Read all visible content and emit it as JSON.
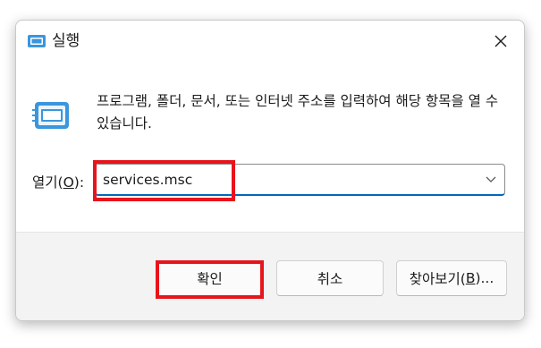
{
  "window": {
    "title": "실행",
    "title_icon": "run-icon",
    "close_icon": "close-icon"
  },
  "content": {
    "description": "프로그램, 폴더, 문서, 또는 인터넷 주소를 입력하여 해당 항목을 열 수 있습니다.",
    "open_label_prefix": "열기(",
    "open_label_mnemonic": "O",
    "open_label_suffix": "):",
    "open_value": "services.msc",
    "dropdown_icon": "chevron-down-icon"
  },
  "buttons": {
    "ok_label": "확인",
    "cancel_label": "취소",
    "browse_prefix": "찾아보기(",
    "browse_mnemonic": "B",
    "browse_suffix": ")..."
  },
  "colors": {
    "highlight": "#e8141c",
    "accent": "#0067c0",
    "footer_bg": "#f3f3f3"
  }
}
